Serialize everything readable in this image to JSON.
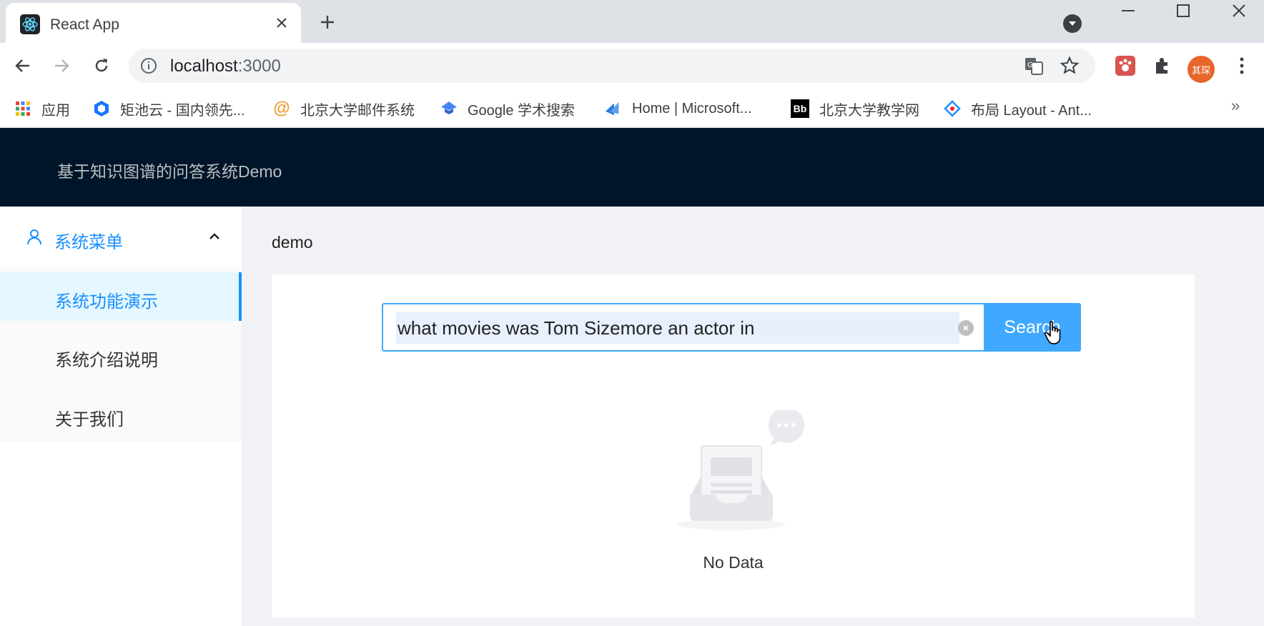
{
  "browser": {
    "tab_title": "React App",
    "url_host": "localhost",
    "url_port": ":3000",
    "profile_initials": "其琛",
    "bookmarks": [
      {
        "label": "应用",
        "icon": "apps-grid-icon"
      },
      {
        "label": "矩池云 - 国内领先...",
        "icon": "matpool-icon"
      },
      {
        "label": "北京大学邮件系统",
        "icon": "mail-at-icon"
      },
      {
        "label": "Google 学术搜索",
        "icon": "scholar-icon"
      },
      {
        "label": "Home | Microsoft...",
        "icon": "microsoft-docs-icon"
      },
      {
        "label": "北京大学教学网",
        "icon": "blackboard-icon"
      },
      {
        "label": "布局 Layout - Ant...",
        "icon": "antd-icon"
      }
    ],
    "bookmarks_more": "»"
  },
  "app": {
    "header_title": "基于知识图谱的问答系统Demo",
    "sider": {
      "submenu_label": "系统菜单",
      "items": [
        {
          "label": "系统功能演示",
          "selected": true
        },
        {
          "label": "系统介绍说明",
          "selected": false
        },
        {
          "label": "关于我们",
          "selected": false
        }
      ]
    },
    "breadcrumb": "demo",
    "search": {
      "value": "what movies was Tom Sizemore an actor in",
      "button_label": "Search"
    },
    "empty": {
      "text": "No Data"
    },
    "colors": {
      "header_bg": "#001529",
      "primary": "#1890ff",
      "search_button": "#40a9ff"
    }
  }
}
